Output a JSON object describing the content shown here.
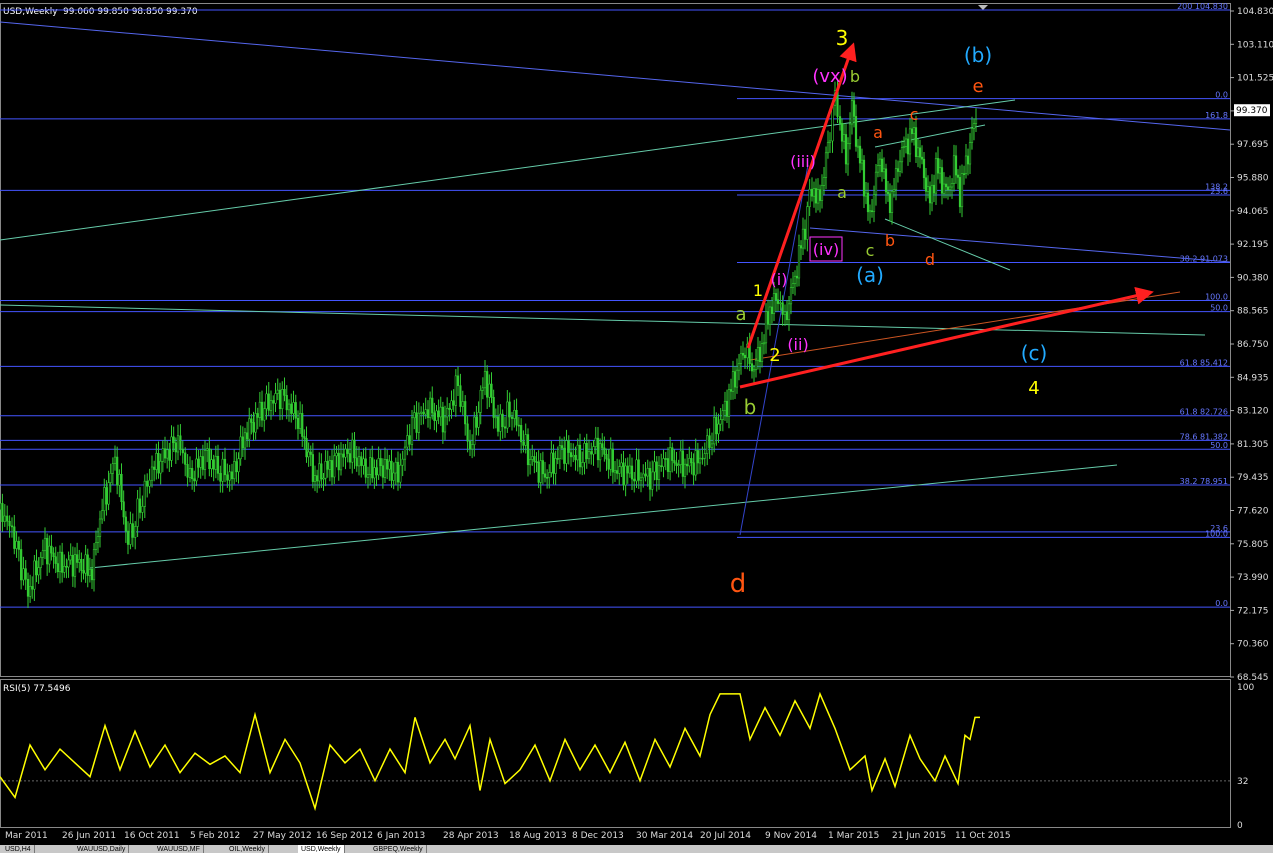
{
  "window": {
    "symbol_label": "USD,Weekly",
    "ohlc_label": "99.060 99.850 98.850 99.370",
    "price_badge": "99.370",
    "colors": {
      "background": "#000000",
      "candles": "#33cc33",
      "grid": "#4455ff",
      "trend": "#66ccaa",
      "red": "#ff2020",
      "rsi": "#ffff00"
    }
  },
  "tabs": [
    {
      "label": "USD,H4",
      "active": false
    },
    {
      "label": "WAUUSD,Daily",
      "active": false
    },
    {
      "label": "WAUUSD,MF",
      "active": false
    },
    {
      "label": "OIL,Weekly",
      "active": false
    },
    {
      "label": "USD,Weekly",
      "active": true
    },
    {
      "label": "GBPEQ,Weekly",
      "active": false
    }
  ],
  "chart_data": {
    "type": "candlestick",
    "timeframe": "Weekly",
    "ylim": [
      68.545,
      104.83
    ],
    "y_ticks": [
      "104.830",
      "103.110",
      "101.525",
      "99.370",
      "97.695",
      "95.880",
      "94.065",
      "92.195",
      "90.380",
      "88.565",
      "86.750",
      "84.935",
      "83.120",
      "81.305",
      "79.435",
      "77.620",
      "75.805",
      "73.990",
      "72.175",
      "70.360",
      "68.545"
    ],
    "x_ticks": [
      "Mar 2011",
      "26 Jun 2011",
      "16 Oct 2011",
      "5 Feb 2012",
      "27 May 2012",
      "16 Sep 2012",
      "6 Jan 2013",
      "28 Apr 2013",
      "18 Aug 2013",
      "8 Dec 2013",
      "30 Mar 2014",
      "20 Jul 2014",
      "9 Nov 2014",
      "1 Mar 2015",
      "21 Jun 2015",
      "11 Oct 2015"
    ],
    "price_path": [
      {
        "x": 0,
        "y": 77.6
      },
      {
        "x": 12,
        "y": 76.5
      },
      {
        "x": 28,
        "y": 73.1
      },
      {
        "x": 45,
        "y": 75.6
      },
      {
        "x": 60,
        "y": 74.5
      },
      {
        "x": 75,
        "y": 74.8
      },
      {
        "x": 92,
        "y": 74.2
      },
      {
        "x": 100,
        "y": 77.2
      },
      {
        "x": 115,
        "y": 80.4
      },
      {
        "x": 128,
        "y": 75.8
      },
      {
        "x": 140,
        "y": 77.8
      },
      {
        "x": 152,
        "y": 79.8
      },
      {
        "x": 165,
        "y": 80.6
      },
      {
        "x": 178,
        "y": 81.4
      },
      {
        "x": 190,
        "y": 79.3
      },
      {
        "x": 205,
        "y": 80.6
      },
      {
        "x": 218,
        "y": 79.8
      },
      {
        "x": 232,
        "y": 79.4
      },
      {
        "x": 245,
        "y": 81.7
      },
      {
        "x": 262,
        "y": 83.1
      },
      {
        "x": 280,
        "y": 83.9
      },
      {
        "x": 298,
        "y": 82.6
      },
      {
        "x": 315,
        "y": 79.3
      },
      {
        "x": 332,
        "y": 80.1
      },
      {
        "x": 350,
        "y": 80.8
      },
      {
        "x": 368,
        "y": 79.7
      },
      {
        "x": 385,
        "y": 80.0
      },
      {
        "x": 398,
        "y": 79.5
      },
      {
        "x": 412,
        "y": 82.3
      },
      {
        "x": 428,
        "y": 83.1
      },
      {
        "x": 445,
        "y": 82.5
      },
      {
        "x": 458,
        "y": 84.5
      },
      {
        "x": 470,
        "y": 80.8
      },
      {
        "x": 485,
        "y": 84.9
      },
      {
        "x": 498,
        "y": 82.1
      },
      {
        "x": 512,
        "y": 83.0
      },
      {
        "x": 528,
        "y": 80.6
      },
      {
        "x": 545,
        "y": 79.4
      },
      {
        "x": 562,
        "y": 80.9
      },
      {
        "x": 580,
        "y": 80.4
      },
      {
        "x": 598,
        "y": 81.1
      },
      {
        "x": 615,
        "y": 79.8
      },
      {
        "x": 632,
        "y": 79.6
      },
      {
        "x": 650,
        "y": 79.4
      },
      {
        "x": 668,
        "y": 80.4
      },
      {
        "x": 685,
        "y": 80.0
      },
      {
        "x": 700,
        "y": 80.3
      },
      {
        "x": 712,
        "y": 81.6
      },
      {
        "x": 725,
        "y": 83.1
      },
      {
        "x": 735,
        "y": 84.9
      },
      {
        "x": 745,
        "y": 86.4
      },
      {
        "x": 752,
        "y": 85.3
      },
      {
        "x": 760,
        "y": 86.1
      },
      {
        "x": 770,
        "y": 88.6
      },
      {
        "x": 778,
        "y": 89.1
      },
      {
        "x": 785,
        "y": 88.0
      },
      {
        "x": 795,
        "y": 90.3
      },
      {
        "x": 805,
        "y": 93.1
      },
      {
        "x": 812,
        "y": 95.3
      },
      {
        "x": 818,
        "y": 94.3
      },
      {
        "x": 824,
        "y": 95.9
      },
      {
        "x": 830,
        "y": 98.2
      },
      {
        "x": 835,
        "y": 100.3
      },
      {
        "x": 840,
        "y": 98.5
      },
      {
        "x": 846,
        "y": 96.8
      },
      {
        "x": 852,
        "y": 99.6
      },
      {
        "x": 858,
        "y": 97.2
      },
      {
        "x": 864,
        "y": 95.4
      },
      {
        "x": 870,
        "y": 93.3
      },
      {
        "x": 876,
        "y": 95.9
      },
      {
        "x": 882,
        "y": 96.7
      },
      {
        "x": 888,
        "y": 94.2
      },
      {
        "x": 894,
        "y": 95.1
      },
      {
        "x": 900,
        "y": 96.9
      },
      {
        "x": 906,
        "y": 97.5
      },
      {
        "x": 912,
        "y": 98.2
      },
      {
        "x": 918,
        "y": 97.2
      },
      {
        "x": 924,
        "y": 95.9
      },
      {
        "x": 930,
        "y": 94.3
      },
      {
        "x": 936,
        "y": 96.3
      },
      {
        "x": 942,
        "y": 95.5
      },
      {
        "x": 948,
        "y": 94.8
      },
      {
        "x": 954,
        "y": 96.4
      },
      {
        "x": 960,
        "y": 94.9
      },
      {
        "x": 966,
        "y": 96.5
      },
      {
        "x": 972,
        "y": 98.1
      },
      {
        "x": 978,
        "y": 99.4
      }
    ],
    "horizontal_levels": [
      {
        "value": 104.83,
        "label": "200 104.830"
      },
      {
        "value": 100.0,
        "label": "0.0"
      },
      {
        "value": 98.9,
        "label": "161.8"
      },
      {
        "value": 95.0,
        "label": "138.2"
      },
      {
        "value": 94.75,
        "label": "23.6"
      },
      {
        "value": 91.073,
        "label": "38.2 91.073"
      },
      {
        "value": 89.0,
        "label": "100.0"
      },
      {
        "value": 88.4,
        "label": "50.0"
      },
      {
        "value": 85.412,
        "label": "61.8 85.412"
      },
      {
        "value": 82.726,
        "label": "61.8 82.726"
      },
      {
        "value": 81.382,
        "label": "78.6 81.382"
      },
      {
        "value": 80.9,
        "label": "50.0"
      },
      {
        "value": 78.951,
        "label": "38.2 78.951"
      },
      {
        "value": 76.4,
        "label": "23.6"
      },
      {
        "value": 76.1,
        "label": "100.0"
      },
      {
        "value": 72.3,
        "label": "0.0"
      }
    ],
    "rsi": {
      "label": "RSI(5) 77.5496",
      "ylim": [
        0,
        100
      ],
      "ticks": [
        "100",
        "32",
        "0"
      ],
      "level": 32,
      "values": [
        [
          0,
          35
        ],
        [
          15,
          20
        ],
        [
          30,
          58
        ],
        [
          45,
          40
        ],
        [
          60,
          55
        ],
        [
          75,
          45
        ],
        [
          90,
          35
        ],
        [
          105,
          72
        ],
        [
          120,
          40
        ],
        [
          135,
          68
        ],
        [
          150,
          42
        ],
        [
          165,
          58
        ],
        [
          180,
          38
        ],
        [
          195,
          52
        ],
        [
          210,
          44
        ],
        [
          225,
          50
        ],
        [
          240,
          38
        ],
        [
          255,
          80
        ],
        [
          270,
          38
        ],
        [
          285,
          62
        ],
        [
          300,
          45
        ],
        [
          315,
          12
        ],
        [
          330,
          58
        ],
        [
          345,
          45
        ],
        [
          360,
          55
        ],
        [
          375,
          32
        ],
        [
          390,
          55
        ],
        [
          405,
          38
        ],
        [
          415,
          78
        ],
        [
          430,
          45
        ],
        [
          445,
          62
        ],
        [
          455,
          48
        ],
        [
          470,
          72
        ],
        [
          480,
          25
        ],
        [
          490,
          62
        ],
        [
          505,
          30
        ],
        [
          520,
          40
        ],
        [
          535,
          58
        ],
        [
          550,
          32
        ],
        [
          565,
          62
        ],
        [
          580,
          40
        ],
        [
          595,
          58
        ],
        [
          610,
          38
        ],
        [
          625,
          60
        ],
        [
          640,
          32
        ],
        [
          655,
          62
        ],
        [
          670,
          42
        ],
        [
          685,
          70
        ],
        [
          700,
          50
        ],
        [
          710,
          80
        ],
        [
          720,
          95
        ],
        [
          740,
          95
        ],
        [
          750,
          62
        ],
        [
          765,
          85
        ],
        [
          780,
          65
        ],
        [
          795,
          90
        ],
        [
          810,
          70
        ],
        [
          820,
          95
        ],
        [
          835,
          70
        ],
        [
          850,
          40
        ],
        [
          865,
          50
        ],
        [
          872,
          25
        ],
        [
          885,
          48
        ],
        [
          895,
          28
        ],
        [
          910,
          65
        ],
        [
          920,
          48
        ],
        [
          935,
          32
        ],
        [
          945,
          50
        ],
        [
          958,
          30
        ],
        [
          965,
          65
        ],
        [
          970,
          62
        ],
        [
          975,
          78
        ],
        [
          980,
          78
        ]
      ]
    },
    "annotations": [
      {
        "text": "3",
        "color": "#ffff00"
      },
      {
        "text": "(vx)",
        "color": "#ff33ff"
      },
      {
        "text": "b",
        "color": "#99cc33"
      },
      {
        "text": "(b)",
        "color": "#22aaff"
      },
      {
        "text": "e",
        "color": "#ff5511"
      },
      {
        "text": "c",
        "color": "#ff5511"
      },
      {
        "text": "a",
        "color": "#ff5511"
      },
      {
        "text": "(iii)",
        "color": "#ff33ff"
      },
      {
        "text": "a",
        "color": "#99cc33"
      },
      {
        "text": "(iv)",
        "color": "#ff33ff"
      },
      {
        "text": "c",
        "color": "#99cc33"
      },
      {
        "text": "b",
        "color": "#ff5511"
      },
      {
        "text": "d",
        "color": "#ff5511"
      },
      {
        "text": "(a)",
        "color": "#22aaff"
      },
      {
        "text": "(i)",
        "color": "#ff33ff"
      },
      {
        "text": "1",
        "color": "#ffff00"
      },
      {
        "text": "a",
        "color": "#99cc33"
      },
      {
        "text": "2",
        "color": "#ffff00"
      },
      {
        "text": "(ii)",
        "color": "#ff33ff"
      },
      {
        "text": "b",
        "color": "#99cc33"
      },
      {
        "text": "(c)",
        "color": "#22aaff"
      },
      {
        "text": "4",
        "color": "#ffff00"
      },
      {
        "text": "d",
        "color": "#ff5511"
      }
    ]
  }
}
